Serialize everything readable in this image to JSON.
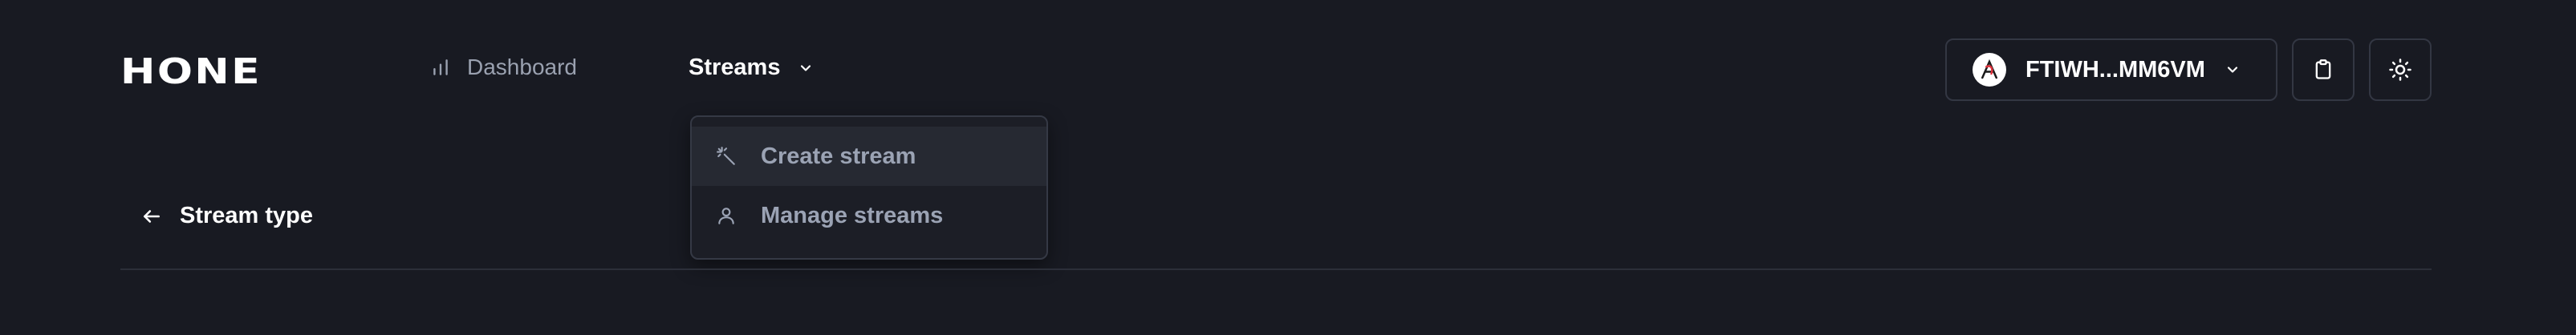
{
  "header": {
    "logo": "HONE",
    "nav": {
      "dashboard_label": "Dashboard",
      "dashboard_icon": "bar-chart-icon",
      "streams_label": "Streams",
      "streams_icon": "chevron-down-icon"
    },
    "wallet": {
      "address": "FTIWH...MM6VM",
      "avatar_icon": "wallet-avatar-icon",
      "chevron_icon": "chevron-down-icon"
    },
    "clipboard_icon": "clipboard-icon",
    "theme_icon": "sun-icon"
  },
  "streams_menu": {
    "items": [
      {
        "label": "Create stream",
        "icon": "magic-wand-icon",
        "active": true
      },
      {
        "label": "Manage streams",
        "icon": "user-icon",
        "active": false
      }
    ]
  },
  "page": {
    "back_icon": "arrow-left-icon",
    "title": "Stream type"
  },
  "colors": {
    "background": "#181a22",
    "muted_text": "#9aa1b0",
    "border": "#333743",
    "avatar_accent": "#e0323c"
  }
}
